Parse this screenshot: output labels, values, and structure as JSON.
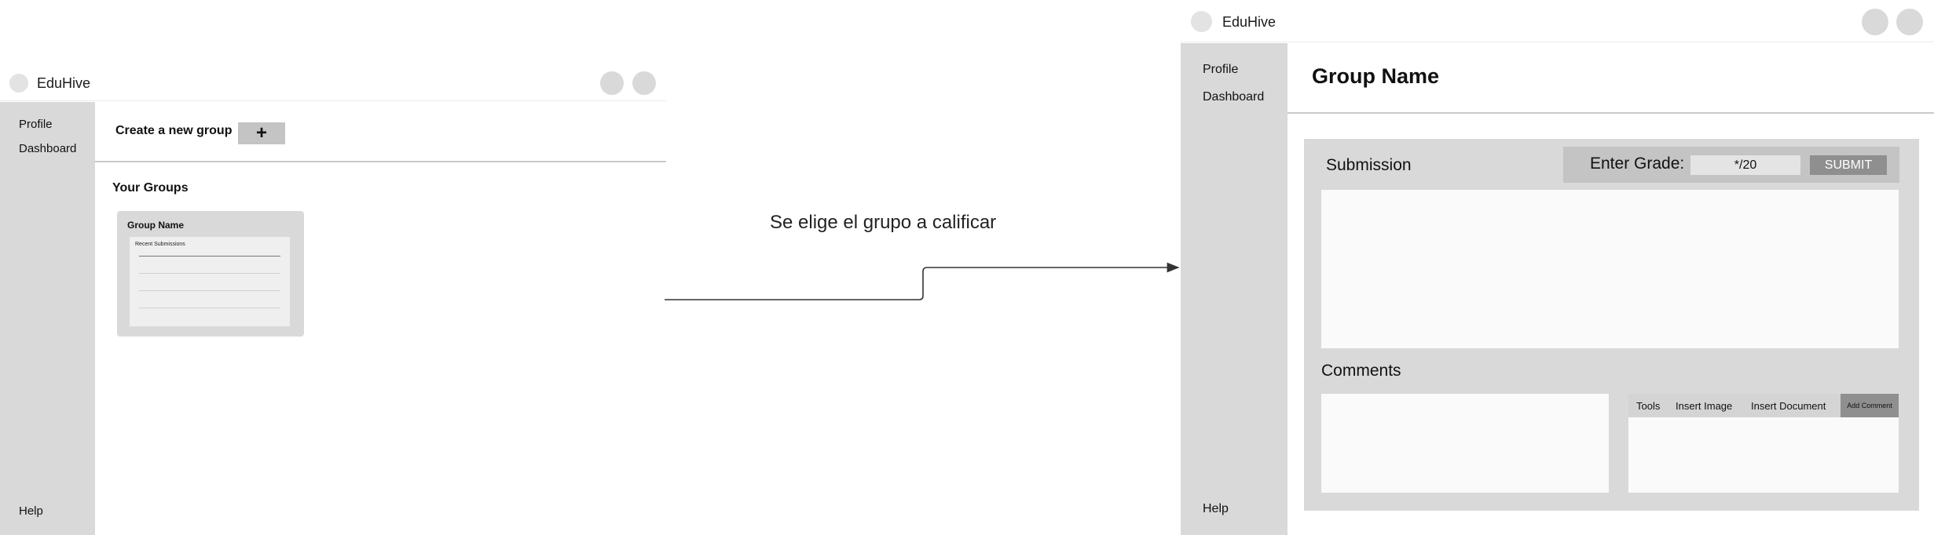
{
  "left_screen": {
    "app_name": "EduHive",
    "sidebar": {
      "profile": "Profile",
      "dashboard": "Dashboard",
      "help": "Help"
    },
    "header": {
      "title": "Create a new group",
      "add_button": "+"
    },
    "your_groups": "Your Groups",
    "group_card": {
      "title": "Group Name",
      "recent": "Recent Submissions"
    }
  },
  "annotation": "Se elige el grupo a calificar",
  "right_screen": {
    "app_name": "EduHive",
    "sidebar": {
      "profile": "Profile",
      "dashboard": "Dashboard",
      "help": "Help"
    },
    "page_title": "Group Name",
    "submission": {
      "title": "Submission",
      "grade_label": "Enter Grade:",
      "grade_value": "*/20",
      "submit": "SUBMIT"
    },
    "comments": {
      "title": "Comments",
      "tools": [
        "Tools",
        "Insert Image",
        "Insert Document"
      ],
      "add_comment": "Add Comment"
    }
  }
}
